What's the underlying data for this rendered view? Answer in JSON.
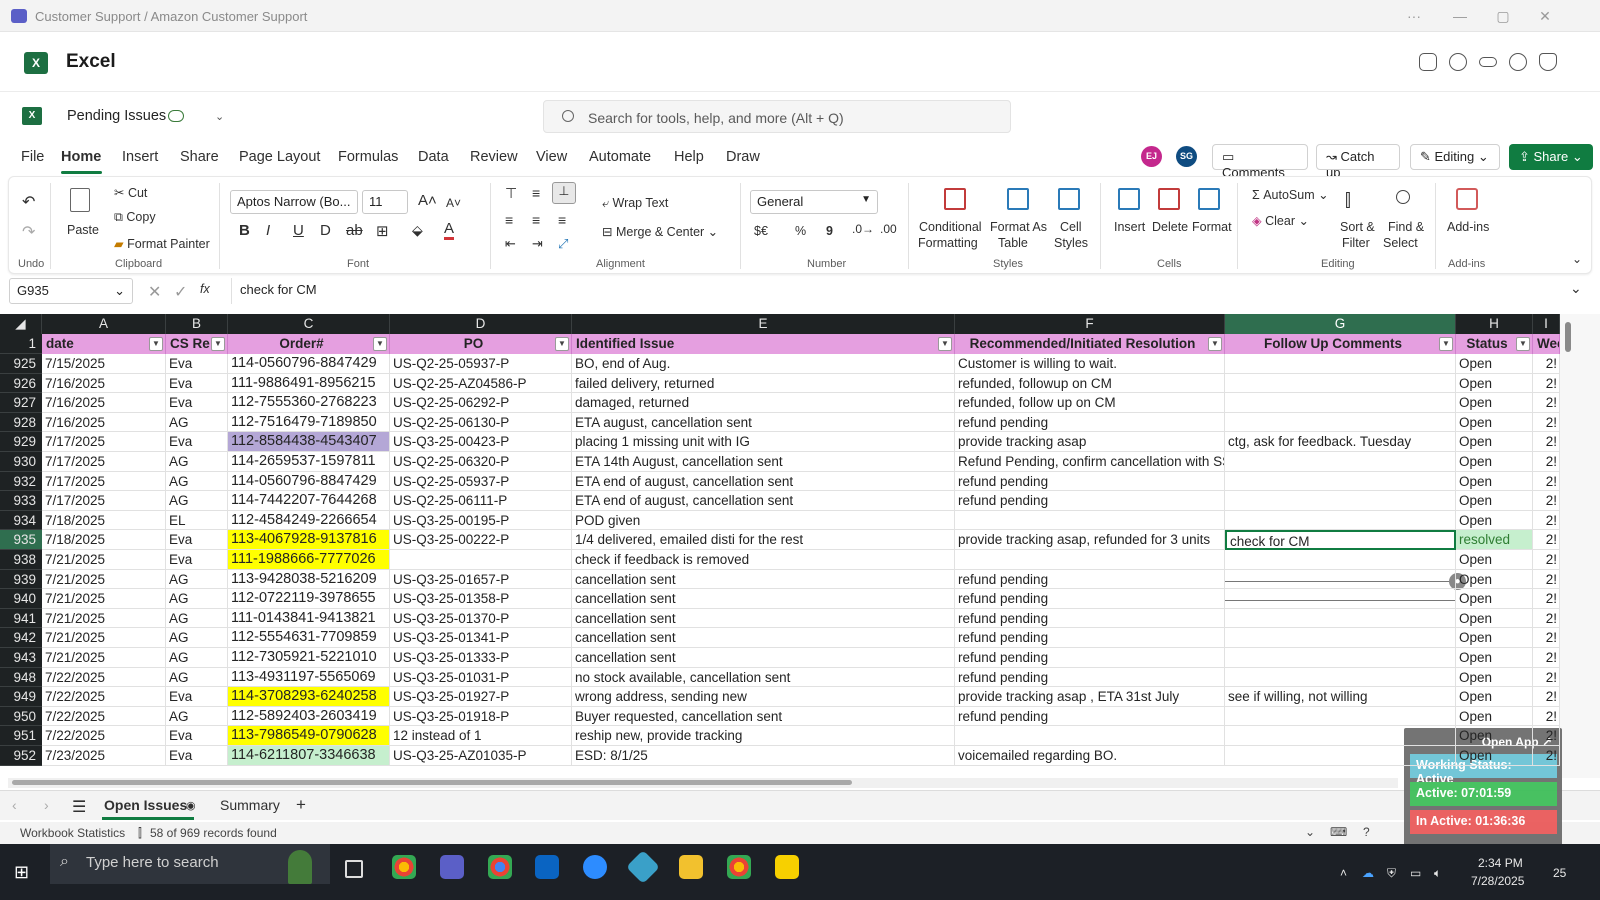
{
  "window": {
    "title": "Customer Support / Amazon Customer Support",
    "controls": [
      "···",
      "—",
      "▢",
      "✕"
    ]
  },
  "app": {
    "name": "Excel"
  },
  "doc": {
    "name": "Pending Issues"
  },
  "search": {
    "placeholder": "Search for tools, help, and more (Alt + Q)"
  },
  "menu": [
    "File",
    "Home",
    "Insert",
    "Share",
    "Page Layout",
    "Formulas",
    "Data",
    "Review",
    "View",
    "Automate",
    "Help",
    "Draw"
  ],
  "avatars": [
    {
      "initials": "EJ",
      "color": "#c4288d"
    },
    {
      "initials": "SG",
      "color": "#0f4c81"
    }
  ],
  "top_buttons": {
    "comments": "Comments",
    "catchup": "Catch up",
    "editing": "Editing",
    "share": "Share"
  },
  "ribbon": {
    "undo_group": "Undo",
    "clipboard": {
      "paste": "Paste",
      "cut": "Cut",
      "copy": "Copy",
      "format_painter": "Format Painter",
      "group": "Clipboard"
    },
    "font": {
      "name": "Aptos Narrow (Bo...",
      "size": "11",
      "group": "Font"
    },
    "alignment": {
      "wrap": "Wrap Text",
      "merge": "Merge & Center",
      "group": "Alignment"
    },
    "number": {
      "format": "General",
      "currency": "$€",
      "percent": "%",
      "comma": "9",
      "group": "Number"
    },
    "styles": {
      "conditional1": "Conditional",
      "conditional2": "Formatting",
      "format_as1": "Format As",
      "format_as2": "Table",
      "cell1": "Cell",
      "cell2": "Styles",
      "group": "Styles"
    },
    "cells": {
      "insert": "Insert",
      "delete": "Delete",
      "format": "Format",
      "group": "Cells"
    },
    "editing": {
      "autosum": "AutoSum",
      "clear": "Clear",
      "sort1": "Sort &",
      "sort2": "Filter",
      "find1": "Find &",
      "find2": "Select",
      "group": "Editing"
    },
    "addins": {
      "label": "Add-ins",
      "group": "Add-ins"
    }
  },
  "formula_bar": {
    "cell_ref": "G935",
    "content": "check for CM",
    "fx": "fx"
  },
  "columns": [
    "A",
    "B",
    "C",
    "D",
    "E",
    "F",
    "G",
    "H",
    "I"
  ],
  "headers": [
    "date",
    "CS Re",
    "Order#",
    "PO",
    "Identified Issue",
    "Recommended/Initiated Resolution",
    "Follow Up Comments",
    "Status",
    "Week"
  ],
  "rows": [
    {
      "n": "925",
      "date": "7/15/2025",
      "cs": "Eva",
      "order": "114-0560796-8847429",
      "po": "US-Q2-25-05937-P",
      "issue": "BO, end of Aug.",
      "res": "Customer is willing to wait.",
      "follow": "",
      "status": "Open",
      "week": "2!"
    },
    {
      "n": "926",
      "date": "7/16/2025",
      "cs": "Eva",
      "order": "111-9886491-8956215",
      "po": "US-Q2-25-AZ04586-P",
      "issue": "failed delivery, returned",
      "res": "refunded, followup on CM",
      "follow": "",
      "status": "Open",
      "week": "2!"
    },
    {
      "n": "927",
      "date": "7/16/2025",
      "cs": "Eva",
      "order": "112-7555360-2768223",
      "po": "US-Q2-25-06292-P",
      "issue": "damaged, returned",
      "res": "refunded, follow up on CM",
      "follow": "",
      "status": "Open",
      "week": "2!"
    },
    {
      "n": "928",
      "date": "7/16/2025",
      "cs": "AG",
      "order": "112-7516479-7189850",
      "po": "US-Q2-25-06130-P",
      "issue": "ETA august, cancellation sent",
      "res": "refund pending",
      "follow": "",
      "status": "Open",
      "week": "2!"
    },
    {
      "n": "929",
      "date": "7/17/2025",
      "cs": "Eva",
      "order": "112-8584438-4543407",
      "po": "US-Q3-25-00423-P",
      "issue": "placing 1 missing unit with IG",
      "res": "provide tracking asap",
      "follow": "ctg, ask for feedback. Tuesday",
      "status": "Open",
      "week": "2!",
      "orderbg": "#b4a7d6"
    },
    {
      "n": "930",
      "date": "7/17/2025",
      "cs": "AG",
      "order": "114-2659537-1597811",
      "po": "US-Q2-25-06320-P",
      "issue": "ETA 14th August, cancellation sent",
      "res": "Refund Pending, confirm cancellation with SS.",
      "follow": "",
      "status": "Open",
      "week": "2!"
    },
    {
      "n": "932",
      "date": "7/17/2025",
      "cs": "AG",
      "order": "114-0560796-8847429",
      "po": "US-Q2-25-05937-P",
      "issue": "ETA end of august, cancellation sent",
      "res": "refund pending",
      "follow": "",
      "status": "Open",
      "week": "2!"
    },
    {
      "n": "933",
      "date": "7/17/2025",
      "cs": "AG",
      "order": "114-7442207-7644268",
      "po": "US-Q2-25-06111-P",
      "issue": "ETA end of august, cancellation sent",
      "res": "refund pending",
      "follow": "",
      "status": "Open",
      "week": "2!"
    },
    {
      "n": "934",
      "date": "7/18/2025",
      "cs": "EL",
      "order": "112-4584249-2266654",
      "po": "US-Q3-25-00195-P",
      "issue": "POD given",
      "res": "",
      "follow": "",
      "status": "Open",
      "week": "2!"
    },
    {
      "n": "935",
      "date": "7/18/2025",
      "cs": "Eva",
      "order": "113-4067928-9137816",
      "po": "US-Q3-25-00222-P",
      "issue": "1/4 delivered, emailed disti for the rest",
      "res": "provide tracking asap, refunded for 3 units",
      "follow": "check for CM",
      "status": "resolved",
      "week": "2!",
      "orderbg": "#ffff00",
      "statusbg": "#c6efce",
      "statuscolor": "#2e7d32",
      "sel": true
    },
    {
      "n": "938",
      "date": "7/21/2025",
      "cs": "Eva",
      "order": "111-1988666-7777026",
      "po": "",
      "issue": "check if feedback is removed",
      "res": "",
      "follow": "",
      "status": "Open",
      "week": "2!",
      "orderbg": "#ffff00"
    },
    {
      "n": "939",
      "date": "7/21/2025",
      "cs": "AG",
      "order": "113-9428038-5216209",
      "po": "US-Q3-25-01657-P",
      "issue": "cancellation sent",
      "res": "refund pending",
      "follow": "",
      "status": "Open",
      "week": "2!"
    },
    {
      "n": "940",
      "date": "7/21/2025",
      "cs": "AG",
      "order": "112-0722119-3978655",
      "po": "US-Q3-25-01358-P",
      "issue": "cancellation sent",
      "res": "refund pending",
      "follow": "",
      "status": "Open",
      "week": "2!"
    },
    {
      "n": "941",
      "date": "7/21/2025",
      "cs": "AG",
      "order": "111-0143841-9413821",
      "po": "US-Q3-25-01370-P",
      "issue": "cancellation sent",
      "res": "refund pending",
      "follow": "",
      "status": "Open",
      "week": "2!"
    },
    {
      "n": "942",
      "date": "7/21/2025",
      "cs": "AG",
      "order": "112-5554631-7709859",
      "po": "US-Q3-25-01341-P",
      "issue": "cancellation sent",
      "res": "refund pending",
      "follow": "",
      "status": "Open",
      "week": "2!"
    },
    {
      "n": "943",
      "date": "7/21/2025",
      "cs": "AG",
      "order": "112-7305921-5221010",
      "po": "US-Q3-25-01333-P",
      "issue": "cancellation sent",
      "res": "refund pending",
      "follow": "",
      "status": "Open",
      "week": "2!"
    },
    {
      "n": "948",
      "date": "7/22/2025",
      "cs": "AG",
      "order": "113-4931197-5565069",
      "po": "US-Q3-25-01031-P",
      "issue": "no stock available, cancellation sent",
      "res": "refund pending",
      "follow": "",
      "status": "Open",
      "week": "2!"
    },
    {
      "n": "949",
      "date": "7/22/2025",
      "cs": "Eva",
      "order": "114-3708293-6240258",
      "po": "US-Q3-25-01927-P",
      "issue": "wrong address, sending new",
      "res": "provide tracking asap , ETA 31st July",
      "follow": "see if willing, not willing",
      "status": "Open",
      "week": "2!",
      "orderbg": "#ffff00"
    },
    {
      "n": "950",
      "date": "7/22/2025",
      "cs": "AG",
      "order": "112-5892403-2603419",
      "po": "US-Q3-25-01918-P",
      "issue": "Buyer requested, cancellation sent",
      "res": "refund pending",
      "follow": "",
      "status": "Open",
      "week": "2!"
    },
    {
      "n": "951",
      "date": "7/22/2025",
      "cs": "Eva",
      "order": "113-7986549-0790628",
      "po": "12 instead of 1",
      "issue": "reship new, provide tracking",
      "res": "",
      "follow": "",
      "status": "Open",
      "week": "2!",
      "orderbg": "#ffff00"
    },
    {
      "n": "952",
      "date": "7/23/2025",
      "cs": "Eva",
      "order": "114-6211807-3346638",
      "po": "US-Q3-25-AZ01035-P",
      "issue": " ESD: 8/1/25",
      "res": "voicemailed regarding BO.",
      "follow": "",
      "status": "Open",
      "week": "2!",
      "orderbg": "#c6efce"
    }
  ],
  "sheets": [
    "Open Issues",
    "Summary"
  ],
  "status": {
    "stats": "Workbook Statistics",
    "records": "58 of 969 records found"
  },
  "taskbar": {
    "search": "Type here to search",
    "time": "2:34 PM",
    "date": "7/28/2025",
    "notif": "25"
  },
  "widget": {
    "open_app": "Open App",
    "working": "Working Status: Active",
    "active": "Active: 07:01:59",
    "inactive": "In Active: 01:36:36"
  }
}
